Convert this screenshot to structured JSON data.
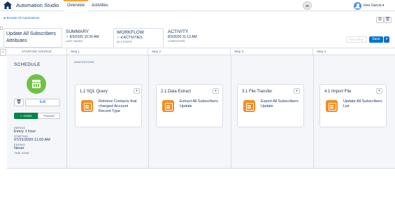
{
  "app": {
    "title": "Automation Studio",
    "tabs": [
      "Overview",
      "Activities"
    ],
    "user_name": "Ines Garcia ▾"
  },
  "breadcrumb": {
    "browse_label": "⮜ Browse All Automations"
  },
  "automation": {
    "name": "Update All Subscribers Attributes"
  },
  "summary_tabs": [
    {
      "title": "SUMMARY",
      "line1": "8/3/2020 10:26 AM",
      "line2": "LAST SAVED"
    },
    {
      "title": "WORKFLOW",
      "line1": "4 ACTIVITIES",
      "line2": "IN 4 STEPS"
    },
    {
      "title": "ACTIVITY",
      "line1": "8/3/2020 11:12 AM",
      "line2": "COMPLETED"
    }
  ],
  "actions": {
    "pause_label": "Run Once",
    "save_label": "Save",
    "save_dropdown": "▾"
  },
  "columns": {
    "source_header": "STARTING SOURCE",
    "steps": [
      "Step 1",
      "Step 2",
      "Step 3",
      "Step 4"
    ]
  },
  "schedule": {
    "label": "SCHEDULE",
    "edit_label": "Edit",
    "active_label": "✓ Active",
    "paused_label": "Paused",
    "repeat_label": "REPEAT:",
    "repeat_value": "Every 1 hour",
    "starting_label": "STARTING:",
    "starting_value": "07/31/2020 11:00 AM",
    "ending_label": "ENDING:",
    "ending_value": "Never",
    "timezone_label": "TIME ZONE:"
  },
  "annotations_label": "ANNOTATIONS",
  "activities": [
    {
      "title": "1.1 SQL Query",
      "text": "Retrieve Contacts that changed Account Record Type",
      "icon": "sql-query-icon"
    },
    {
      "title": "2.1 Data Extract",
      "text": "Extract All Subscribers Update",
      "icon": "data-extract-icon"
    },
    {
      "title": "3.1 File Transfer",
      "text": "Export All Subscribers Update",
      "icon": "file-transfer-icon"
    },
    {
      "title": "4.1 Import File",
      "text": "Update All Subscribers List",
      "icon": "import-file-icon"
    }
  ],
  "colors": {
    "accent": "#0070d2",
    "active": "#04844b",
    "activity_icon": "#f88b1f",
    "schedule_icon": "#72c145"
  }
}
